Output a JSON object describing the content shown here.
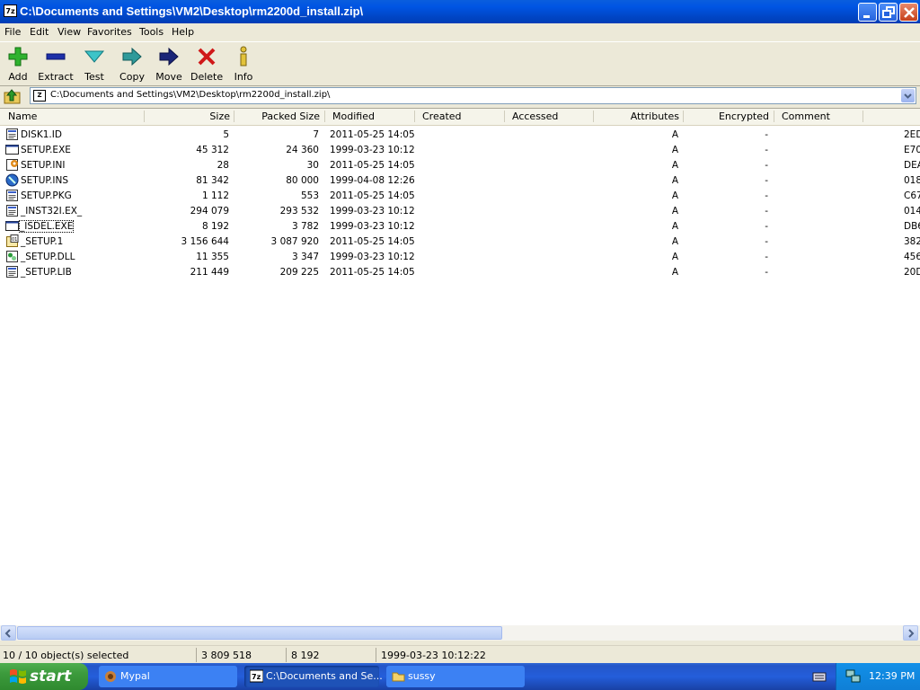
{
  "window": {
    "title": "C:\\Documents and Settings\\VM2\\Desktop\\rm2200d_install.zip\\",
    "app_icon": "7z"
  },
  "menu": [
    "File",
    "Edit",
    "View",
    "Favorites",
    "Tools",
    "Help"
  ],
  "toolbar": {
    "add": "Add",
    "extract": "Extract",
    "test": "Test",
    "copy": "Copy",
    "move": "Move",
    "delete": "Delete",
    "info": "Info"
  },
  "address": {
    "path": "C:\\Documents and Settings\\VM2\\Desktop\\rm2200d_install.zip\\"
  },
  "columns": [
    "Name",
    "Size",
    "Packed Size",
    "Modified",
    "Created",
    "Accessed",
    "Attributes",
    "Encrypted",
    "Comment"
  ],
  "files": [
    {
      "name": "DISK1.ID",
      "size": "5",
      "packed": "7",
      "modified": "2011-05-25 14:05",
      "attr": "A",
      "enc": "-",
      "crc": "2ED",
      "icon": "generic-file-icon"
    },
    {
      "name": "SETUP.EXE",
      "size": "45 312",
      "packed": "24 360",
      "modified": "1999-03-23 10:12",
      "attr": "A",
      "enc": "-",
      "crc": "E70",
      "icon": "exe-icon"
    },
    {
      "name": "SETUP.INI",
      "size": "28",
      "packed": "30",
      "modified": "2011-05-25 14:05",
      "attr": "A",
      "enc": "-",
      "crc": "DEA",
      "icon": "ini-icon"
    },
    {
      "name": "SETUP.INS",
      "size": "81 342",
      "packed": "80 000",
      "modified": "1999-04-08 12:26",
      "attr": "A",
      "enc": "-",
      "crc": "018",
      "icon": "ins-icon"
    },
    {
      "name": "SETUP.PKG",
      "size": "1 112",
      "packed": "553",
      "modified": "2011-05-25 14:05",
      "attr": "A",
      "enc": "-",
      "crc": "C67",
      "icon": "generic-file-icon"
    },
    {
      "name": "_INST32I.EX_",
      "size": "294 079",
      "packed": "293 532",
      "modified": "1999-03-23 10:12",
      "attr": "A",
      "enc": "-",
      "crc": "014",
      "icon": "generic-file-icon"
    },
    {
      "name": "_ISDEL.EXE",
      "size": "8 192",
      "packed": "3 782",
      "modified": "1999-03-23 10:12",
      "attr": "A",
      "enc": "-",
      "crc": "DB6",
      "icon": "exe-icon"
    },
    {
      "name": "_SETUP.1",
      "size": "3 156 644",
      "packed": "3 087 920",
      "modified": "2011-05-25 14:05",
      "attr": "A",
      "enc": "-",
      "crc": "382",
      "icon": "binary-file-icon"
    },
    {
      "name": "_SETUP.DLL",
      "size": "11 355",
      "packed": "3 347",
      "modified": "1999-03-23 10:12",
      "attr": "A",
      "enc": "-",
      "crc": "456",
      "icon": "dll-icon"
    },
    {
      "name": "_SETUP.LIB",
      "size": "211 449",
      "packed": "209 225",
      "modified": "2011-05-25 14:05",
      "attr": "A",
      "enc": "-",
      "crc": "20D",
      "icon": "generic-file-icon"
    }
  ],
  "status": {
    "selected": "10 / 10 object(s) selected",
    "total_size": "3 809 518",
    "sel_size": "8 192",
    "date": "1999-03-23 10:12:22"
  },
  "taskbar": {
    "start": "start",
    "tasks": [
      {
        "label": "Mypal",
        "icon": "mypal-icon"
      },
      {
        "label": "C:\\Documents and Se...",
        "icon": "7zip-icon"
      },
      {
        "label": "sussy",
        "icon": "folder-icon"
      }
    ],
    "clock": "12:39 PM"
  },
  "colors": {
    "titlebar": "#0054e3",
    "taskbar": "#245edb",
    "start": "#3c9a3c",
    "active_task": "#1e52b7"
  }
}
